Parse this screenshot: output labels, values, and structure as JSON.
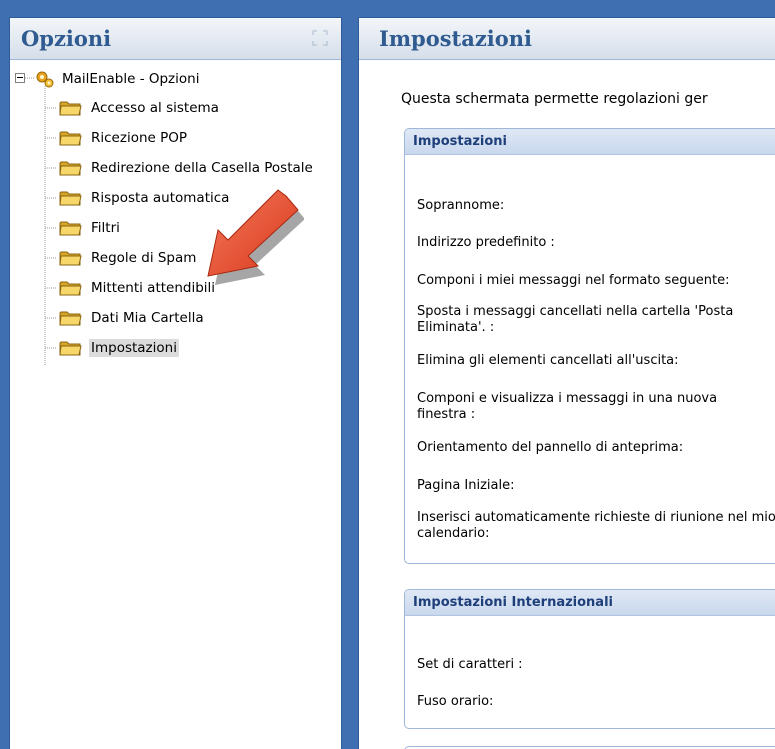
{
  "left_panel": {
    "title": "Opzioni",
    "root_label": "MailEnable - Opzioni",
    "items": [
      {
        "label": "Accesso al sistema"
      },
      {
        "label": "Ricezione POP"
      },
      {
        "label": "Redirezione della Casella Postale"
      },
      {
        "label": "Risposta automatica"
      },
      {
        "label": "Filtri"
      },
      {
        "label": "Regole di Spam"
      },
      {
        "label": "Mittenti attendibili"
      },
      {
        "label": "Dati Mia Cartella"
      },
      {
        "label": "Impostazioni",
        "selected": true
      }
    ]
  },
  "right_panel": {
    "title": "Impostazioni",
    "intro": "Questa schermata permette regolazioni ger",
    "groups": [
      {
        "title": "Impostazioni",
        "fields": [
          "Soprannome:",
          "Indirizzo predefinito :",
          "Componi i miei messaggi nel formato seguente:",
          "Sposta i messaggi cancellati nella cartella 'Posta Eliminata'. :",
          "Elimina gli elementi cancellati all'uscita:",
          "Componi e visualizza i messaggi in una nuova finestra :",
          "Orientamento del pannello di anteprima:",
          "Pagina Iniziale:",
          "Inserisci automaticamente richieste di riunione nel mio calendario:"
        ]
      },
      {
        "title": "Impostazioni Internazionali",
        "fields": [
          "Set di caratteri :",
          "Fuso orario:"
        ]
      }
    ]
  },
  "colors": {
    "background": "#3f6fb0",
    "header_title": "#2f5b90",
    "group_title": "#1f3f7a",
    "pointer_arrow": "#e8452a"
  },
  "icons": [
    "gear-icon",
    "folder-icon",
    "collapse-icon",
    "pointer-arrow"
  ]
}
